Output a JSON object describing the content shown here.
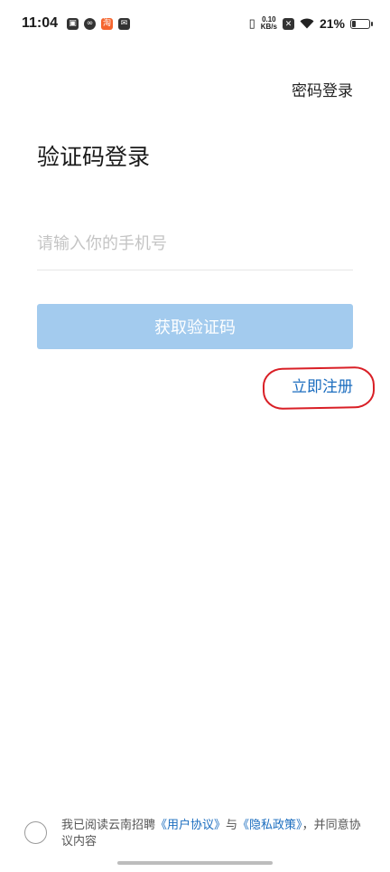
{
  "status_bar": {
    "time": "11:04",
    "net_speed_value": "0.10",
    "net_speed_unit": "KB/s",
    "battery_percent": "21%",
    "battery_level": 0.21,
    "notif_icons": [
      "wallet-icon",
      "link-icon",
      "taobao-icon",
      "mail-icon"
    ]
  },
  "header": {
    "password_login_link": "密码登录"
  },
  "main": {
    "title": "验证码登录",
    "phone_placeholder": "请输入你的手机号",
    "get_code_button": "获取验证码",
    "register_link": "立即注册"
  },
  "agreement": {
    "prefix": "我已阅读云南招聘",
    "user_agreement": "《用户协议》",
    "and": "与",
    "privacy_policy": "《隐私政策》",
    "suffix": "，并同意协议内容"
  },
  "colors": {
    "accent": "#1b6dbf",
    "button_disabled": "#a3cbee",
    "annotation": "#d91f26"
  }
}
